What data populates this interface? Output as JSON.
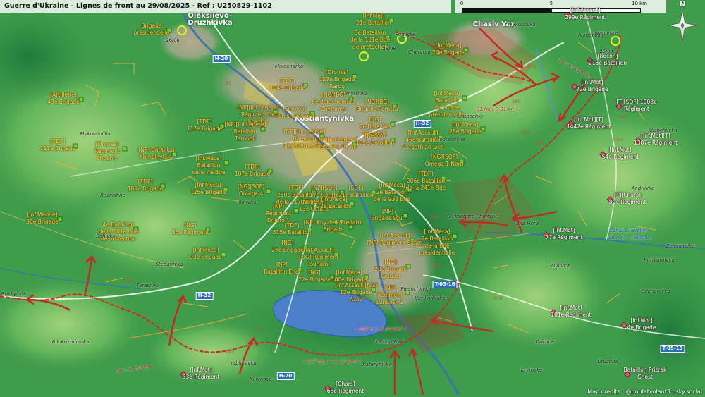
{
  "header": {
    "title": "Guerre d'Ukraine - Lignes de front au 29/08/2025 - Ref : U250829-1102"
  },
  "scale": {
    "labels": [
      "0",
      "5",
      "10 km"
    ]
  },
  "compass": {
    "label": "N"
  },
  "credits": "Map credits : @pouletvolant3.bsky.social",
  "colors": {
    "ukraine_units": "#f4d03f",
    "russia_units": "#ffffff",
    "front_line": "#d02a24",
    "roads": "#ffffff",
    "water": "#3a6fb8"
  },
  "cities": [
    {
      "id": "kostiantynivka",
      "name": "Kostiantynivka"
    },
    {
      "id": "chasiv-yar",
      "name": "Chasiv Yar"
    },
    {
      "id": "druzhkivka",
      "name": "Oleksiievo-\nDruzhkivka"
    }
  ],
  "places": [
    "Molocharka",
    "Novodmytrivka",
    "Stupochky",
    "Predtechyne",
    "Mykolaipillia",
    "Rozkishne",
    "Illinivka",
    "Stepanivka",
    "Ruskyi Yar",
    "Oleksandro-Shultyne",
    "Bila Hora",
    "Kleban-Byk",
    "Katerynivka",
    "Kalynove",
    "Yablunivka",
    "Pleshchiivka",
    "Ivanopillia",
    "Dylivka",
    "Dachne",
    "Ozarianivka",
    "Kurdiumivka",
    "Zelenopillia",
    "Krymske",
    "Druzhba",
    "Klishchiivka",
    "Andriivka",
    "Ivanivske",
    "Mykolaivka",
    "Podilske",
    "Chervone",
    "Sofiivka",
    "Tarasivka",
    "Bilokuzminivka",
    "Virolyubivka"
  ],
  "ukraine_units": [
    "Brigade\nprésidentielle",
    "[Artillerie]\n43e Brigade",
    "[TDF]\n111e Brigade",
    "[Drones]\nRégiment\nPhoenix",
    "[NP] Bataillon\nKhmelnytsky",
    "[TDF]\n117e Brigade",
    "[NP][Inf.Légère]\nRégiment de\nKharkiv",
    "[NP][Inf.Légère]\nBataillon\nTernopil",
    "[Drones]\nPunishersword",
    "[TDF]\n104e Brigade",
    "[Drones]\n127e Brigade\nRarog",
    "3e Bataillon\nde la 101e Bde\nde protection",
    "[Inf.Mot]\n21e Bataillon",
    "[Inf.Méca]\n24e Brigade",
    "[NG][BG]\nBrigade Pomsta",
    "[NG][BG]\n6e détachement\nZhytomyr",
    "[Inf.Méca]\nBataillon\nde la Bde\nprésidentielle",
    "[Inf.Méca]\n28e Brigade",
    "[NG]\n2e Bataillon\nVinnytsia",
    "[NP][Inf.Légère]\nBataillon\nTranscarpathian",
    "[NP][Inf.Légère]\nBataillon Rivne",
    "[Recon]\n152e Bataillon",
    "[Inf.Assaut]\n46e Bataillon\nCarpathian Sich",
    "[NG][SOF]\nOmega 1 Nord",
    "[TDF]\n206e Bataillon\nde la 241e Bde",
    "[TDF]\n107e Brigade",
    "[Inf.Méca]\nBataillon\nde la 4e Bde",
    "[TDF]\n109e Brigade",
    "[Inf.Méca]\n125e Brigade",
    "[NG][SOF]\nOmega 4",
    "[TDF]\n250e Bataillon\nde la 117e Bde",
    "[NP][SOF]\n17e Centre",
    "[NP][SOF]\n13e Centre",
    "[SOF]\n21e Bataillon",
    "[Inf.Méca]\n2e Bataillon\nde la 93e Bde",
    "[Inf.Méca]\n22e Bataillon",
    "[Inf.Marine]\n36e Brigade",
    "4e Bataillon\nde la 101e Bde\nde protection",
    "[NG]\n36e Régiment",
    "[NP]\nRégiment\nDnipro 1",
    "[NP]\nBrigade Lyut",
    "[NP] Khyzhak/Predator\nBrigade",
    "[TDF]\n515e Bataillon",
    "[NG]\n27e Brigade",
    "[Inf.Méca]\n93e Brigade",
    "[Inf.Assaut]\n[NP] Régiment Safari",
    "[Inf.Méca]\n2e Bataillon\nde la Bde\nprésidentielle",
    "[Inf.Assaut]\n[OG] Régiment\nTsunami",
    "[NP]\nBataillon Enei",
    "[NG]\n22e Brigade",
    "[Inf.Méca]\n100e Brigade",
    "[NG]\n20e Brigade\nLyubart",
    "[Inf.Assaut][NG]\n12e Brigade\nAzov",
    "[NP]\nRégiment\nLuhansk 1"
  ],
  "russia_units": [
    "[Inf.Assaut]\n299e Régiment",
    "[Recon]\n215e Bataillon",
    "[Inf.Mot]\n72e Brigade",
    "[Inf.Mot][T]\n1442e Régiment",
    "[T][SOF] 1008e\nRégiment",
    "[Inf.Mot][T]\n1307e Régiment",
    "[Inf.Mot]\n54e Régiment",
    "[T][Chars]\n89e Régiment",
    "[Inf.Mot]\n77e Régiment",
    "[Inf.Mot]\n101e Régiment",
    "[Inf.Mot]\n4e Brigade",
    "Bataillon Prizrak\nGhost",
    "[Chars]\n68e Régiment",
    "[Inf.Mot]\n33e Régiment"
  ],
  "annotations": {
    "area_north": "- 91 ha ( 0.91 km² )",
    "area_south": "- 104 ha ( 1.04 km² )",
    "area_west": "+ 127 ha ( + 1.27 km² )",
    "dates": [
      "26/08",
      "26/08",
      "26/08"
    ],
    "water": "Canal Siverskyi\nDonets - Donbass",
    "routes": [
      "2km to frontline",
      "2km to frontline"
    ]
  },
  "roads": [
    "H-20",
    "H-32",
    "T-05-16",
    "T-05-13",
    "H-20",
    "H-32"
  ],
  "elevations": [
    "230",
    "250",
    "260",
    "240",
    "210",
    "200",
    "220",
    "180",
    "140",
    "110",
    "120",
    "130",
    "100",
    "90",
    "80"
  ]
}
